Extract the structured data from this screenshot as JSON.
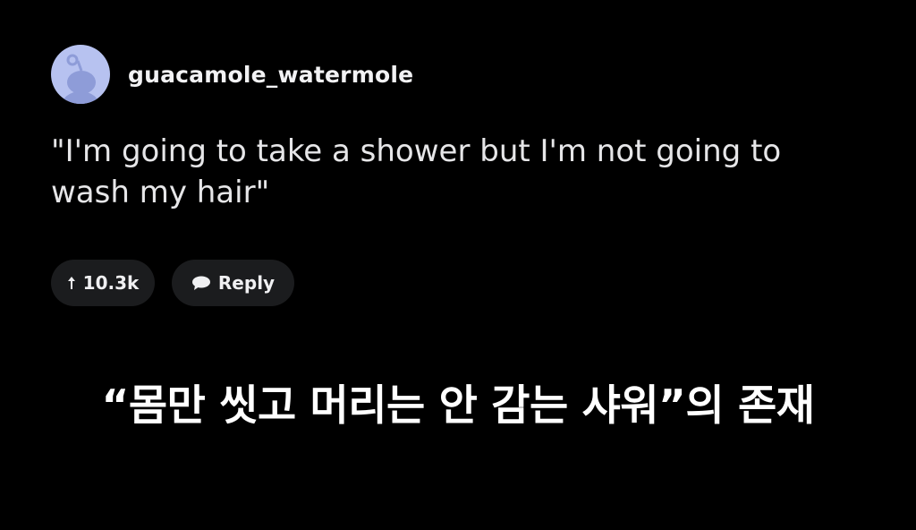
{
  "comment": {
    "username": "guacamole_watermole",
    "avatar_icon": "reddit-snoo-avatar-icon",
    "avatar_bg": "#b7c2f0",
    "text": "\"I'm going to take a shower but I'm not going to wash my hair\"",
    "actions": {
      "upvote_icon": "upvote-arrow-icon",
      "upvote_count": "10.3k",
      "reply_icon": "speech-bubble-icon",
      "reply_label": "Reply"
    }
  },
  "caption": {
    "text": "“몸만 씻고 머리는 안 감는 샤워”의 존재"
  },
  "colors": {
    "background": "#000000",
    "pill_background": "#1b1c1e",
    "text": "#e6e6e8"
  }
}
